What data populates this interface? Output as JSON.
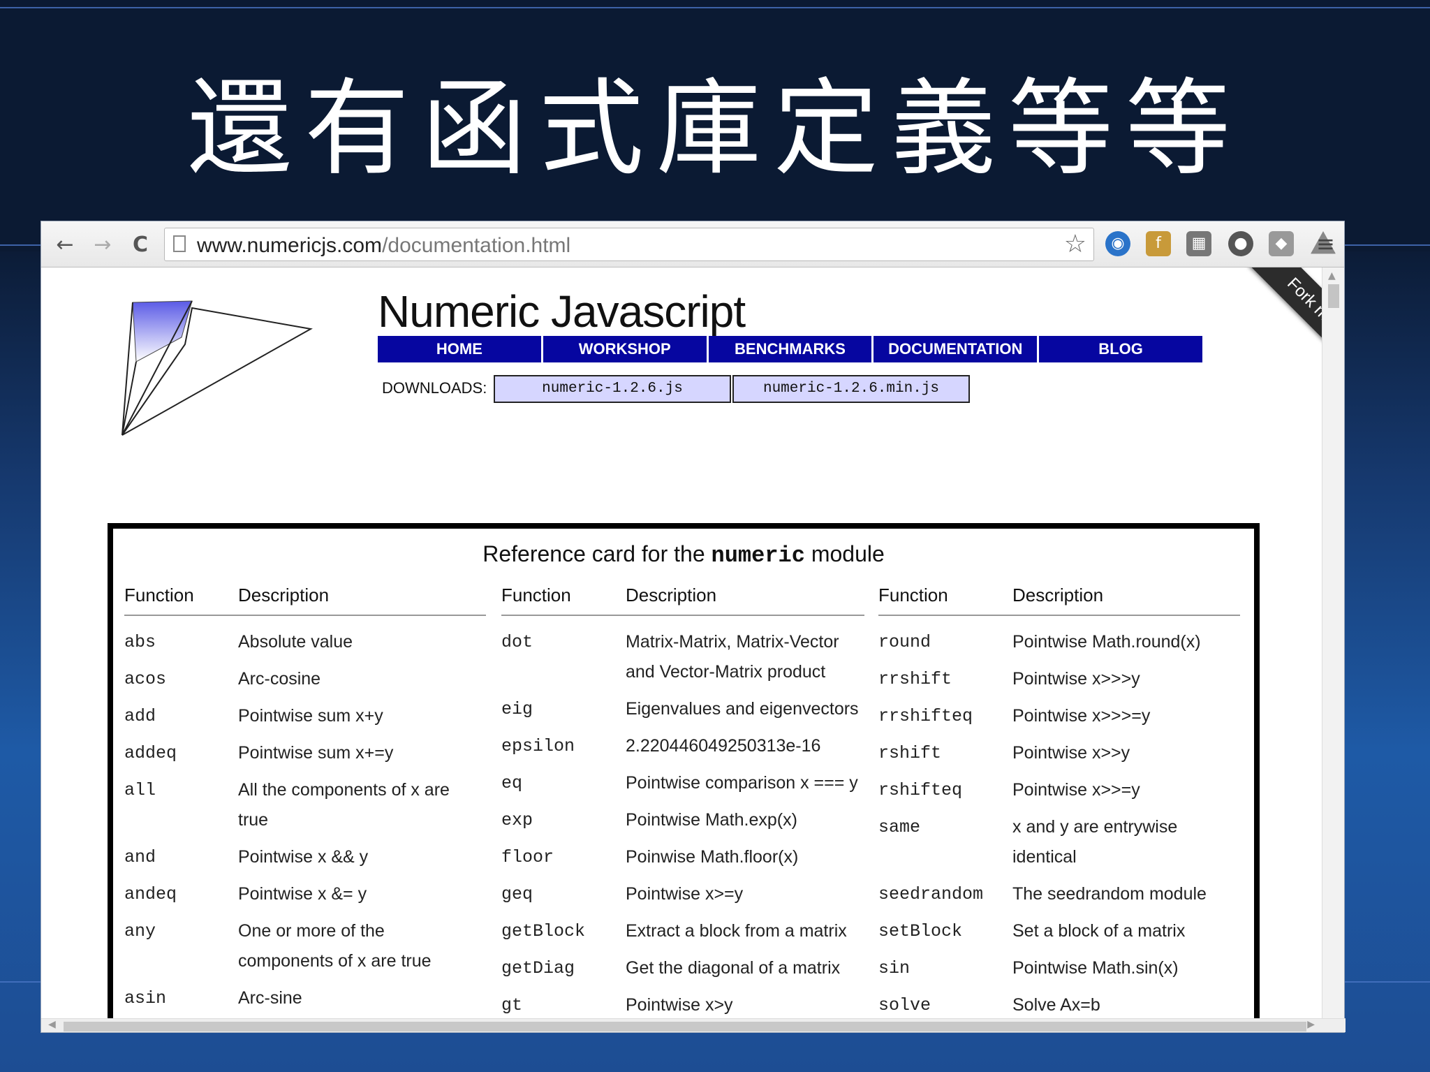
{
  "slide": {
    "title": "還有函式庫定義等等"
  },
  "browser": {
    "url_host": "www.numericjs.com",
    "url_path": "/documentation.html",
    "nav": {
      "back": "←",
      "forward": "→",
      "reload": "C"
    },
    "star": "☆",
    "extensions": [
      "rss-icon",
      "facebook-icon",
      "keyboard-icon",
      "record-icon",
      "dropbox-icon",
      "drive-icon"
    ],
    "menu": "≡"
  },
  "site": {
    "title": "Numeric Javascript",
    "nav": [
      "HOME",
      "WORKSHOP",
      "BENCHMARKS",
      "DOCUMENTATION",
      "BLOG"
    ],
    "downloads_label": "DOWNLOADS:",
    "downloads": [
      "numeric-1.2.6.js",
      "numeric-1.2.6.min.js"
    ],
    "ribbon": "Fork me on GitHub",
    "nav_color": "#0606a0",
    "download_bg": "#d6d6ff"
  },
  "refcard": {
    "title_pre": "Reference card for the ",
    "title_mono": "numeric",
    "title_post": " module",
    "col1": {
      "h_fn": "Function",
      "h_desc": "Description",
      "rows": [
        {
          "fn": "abs",
          "desc": "Absolute value"
        },
        {
          "fn": "acos",
          "desc": "Arc-cosine"
        },
        {
          "fn": "add",
          "desc": "Pointwise sum x+y"
        },
        {
          "fn": "addeq",
          "desc": "Pointwise sum x+=y"
        },
        {
          "fn": "all",
          "desc": "All the components of x are true"
        },
        {
          "fn": "and",
          "desc": "Pointwise x && y"
        },
        {
          "fn": "andeq",
          "desc": "Pointwise x &= y"
        },
        {
          "fn": "any",
          "desc": "One or more of the components of x are true"
        },
        {
          "fn": "asin",
          "desc": "Arc-sine"
        }
      ]
    },
    "col2": {
      "h_fn": "Function",
      "h_desc": "Description",
      "rows": [
        {
          "fn": "dot",
          "desc": "Matrix-Matrix, Matrix-Vector and Vector-Matrix product"
        },
        {
          "fn": "eig",
          "desc": "Eigenvalues and eigenvectors"
        },
        {
          "fn": "epsilon",
          "desc": "2.220446049250313e-16"
        },
        {
          "fn": "eq",
          "desc": "Pointwise comparison x === y"
        },
        {
          "fn": "exp",
          "desc": "Pointwise Math.exp(x)"
        },
        {
          "fn": "floor",
          "desc": "Poinwise Math.floor(x)"
        },
        {
          "fn": "geq",
          "desc": "Pointwise x>=y"
        },
        {
          "fn": "getBlock",
          "desc": "Extract a block from a matrix"
        },
        {
          "fn": "getDiag",
          "desc": "Get the diagonal of a matrix"
        },
        {
          "fn": "gt",
          "desc": "Pointwise x>y"
        }
      ]
    },
    "col3": {
      "h_fn": "Function",
      "h_desc": "Description",
      "rows": [
        {
          "fn": "round",
          "desc": "Pointwise Math.round(x)"
        },
        {
          "fn": "rrshift",
          "desc": "Pointwise x>>>y"
        },
        {
          "fn": "rrshifteq",
          "desc": "Pointwise x>>>=y"
        },
        {
          "fn": "rshift",
          "desc": "Pointwise x>>y"
        },
        {
          "fn": "rshifteq",
          "desc": "Pointwise x>>=y"
        },
        {
          "fn": "same",
          "desc": "x and y are entrywise identical"
        },
        {
          "fn": "seedrandom",
          "desc": "The seedrandom module"
        },
        {
          "fn": "setBlock",
          "desc": "Set a block of a matrix"
        },
        {
          "fn": "sin",
          "desc": "Pointwise Math.sin(x)"
        },
        {
          "fn": "solve",
          "desc": "Solve Ax=b"
        }
      ]
    }
  }
}
